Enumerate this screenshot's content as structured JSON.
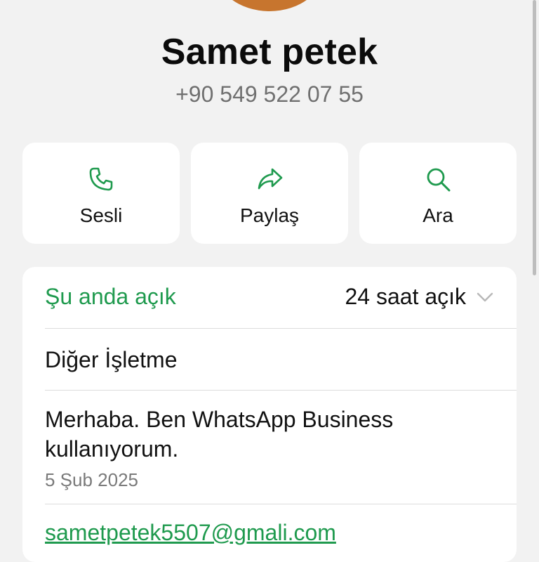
{
  "profile": {
    "name": "Samet petek",
    "phone": "+90 549 522 07 55"
  },
  "actions": [
    {
      "label": "Sesli",
      "icon": "phone-icon"
    },
    {
      "label": "Paylaş",
      "icon": "share-icon"
    },
    {
      "label": "Ara",
      "icon": "search-icon"
    }
  ],
  "info": {
    "status": "Şu anda açık",
    "hours": "24 saat açık",
    "category": "Diğer İşletme",
    "about": "Merhaba. Ben WhatsApp Business kullanıyorum.",
    "about_date": "5 Şub 2025",
    "email": "sametpetek5507@gmali.com"
  },
  "colors": {
    "accent": "#1f9a4e",
    "background": "#f2f2f2",
    "card": "#ffffff"
  }
}
